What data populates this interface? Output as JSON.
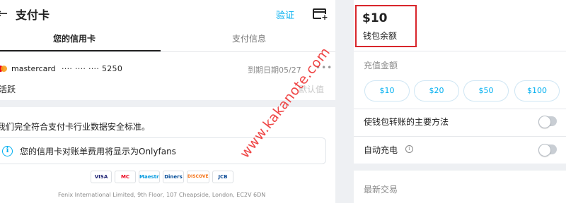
{
  "header": {
    "back_icon": "arrow-left-icon",
    "title": "支付卡",
    "verify": "验证",
    "add_card_icon": "add-card-icon"
  },
  "tabs": [
    {
      "label": "您的信用卡",
      "active": true
    },
    {
      "label": "支付信息",
      "active": false
    }
  ],
  "card": {
    "brand": "mastercard",
    "number": "···· ···· ···· 5250",
    "expiry": "到期日期05/27",
    "name": "活跃",
    "default_label": "默认值"
  },
  "security": {
    "pci_text": "我们完全符合支付卡行业数据安全标准。",
    "notice": "您的信用卡对账单费用将显示为Onlyfans"
  },
  "card_brands": [
    "VISA",
    "MC",
    "Maestro",
    "Diners",
    "DISCOVER",
    "JCB"
  ],
  "company_address": "Fenix International Limited, 9th Floor, 107 Cheapside, London, EC2V 6DN",
  "watermark": "www.kakanote.com",
  "wallet": {
    "amount": "$10",
    "label": "钱包余额"
  },
  "recharge": {
    "label": "充值金额",
    "amounts": [
      "$10",
      "$20",
      "$50",
      "$100"
    ]
  },
  "settings": {
    "primary_method": "使钱包转账的主要方法",
    "auto_recharge": "自动充电"
  },
  "recent_transactions": "最新交易",
  "colors": {
    "accent": "#00aff0",
    "highlight_border": "#d8262b",
    "watermark": "#e33333"
  }
}
